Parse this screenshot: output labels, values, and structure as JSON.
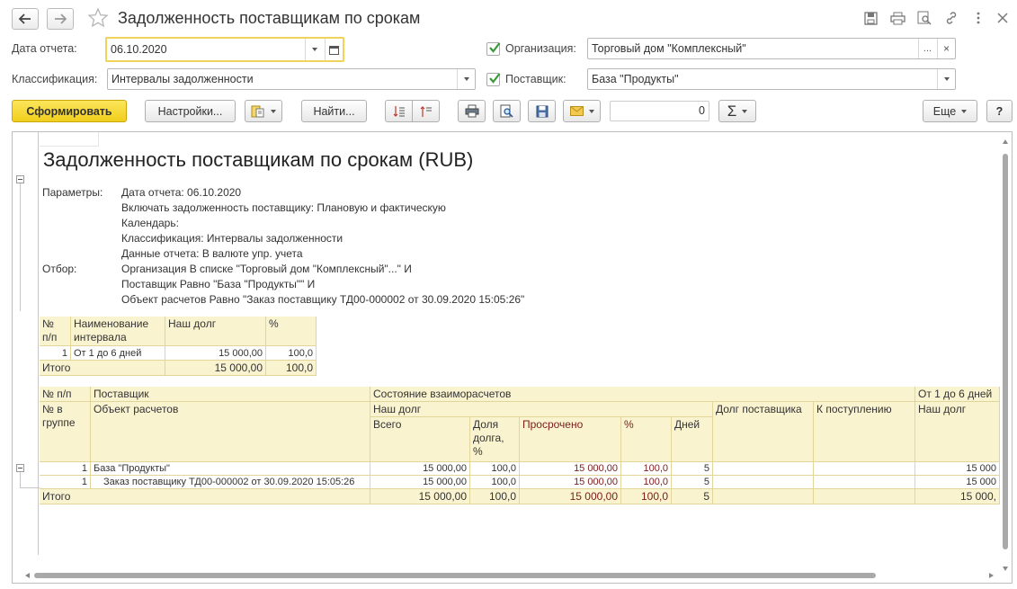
{
  "window": {
    "title": "Задолженность поставщикам по срокам"
  },
  "form": {
    "report_date_label": "Дата отчета:",
    "report_date_value": "06.10.2020",
    "classification_label": "Классификация:",
    "classification_value": "Интервалы задолженности",
    "organization_label": "Организация:",
    "organization_value": "Торговый дом \"Комплексный\"",
    "organization_checked": true,
    "organization_more": "...",
    "organization_clear": "×",
    "supplier_label": "Поставщик:",
    "supplier_value": "База \"Продукты\"",
    "supplier_checked": true
  },
  "toolbar": {
    "generate_label": "Сформировать",
    "settings_label": "Настройки...",
    "find_label": "Найти...",
    "sum_value": "0",
    "sum_symbol": "Σ",
    "more_label": "Еще",
    "help_label": "?"
  },
  "report": {
    "title": "Задолженность поставщикам по срокам (RUB)",
    "params_label": "Параметры:",
    "params": [
      "Дата отчета: 06.10.2020",
      "Включать задолженность поставщику: Плановую и фактическую",
      "Календарь:",
      "Классификация: Интервалы задолженности",
      "Данные отчета: В валюте упр. учета"
    ],
    "filter_label": "Отбор:",
    "filters": [
      "Организация В списке \"Торговый дом \"Комплексный\"...\" И",
      "Поставщик Равно \"База \"Продукты\"\" И",
      "Объект расчетов Равно \"Заказ поставщику ТД00-000002 от 30.09.2020 15:05:26\""
    ],
    "summary": {
      "headers": [
        "№\nп/п",
        "Наименование\nинтервала",
        "Наш долг",
        "%"
      ],
      "rows": [
        {
          "num": "1",
          "name": "От 1 до 6 дней",
          "debt": "15 000,00",
          "pct": "100,0"
        }
      ],
      "total": {
        "label": "Итого",
        "debt": "15 000,00",
        "pct": "100,0"
      }
    },
    "main": {
      "h_num": "№ п/п",
      "h_supplier": "Поставщик",
      "h_state": "Состояние взаиморасчетов",
      "h_interval": "От 1 до 6 дней",
      "h_num_group": "№ в\nгруппе",
      "h_object": "Объект расчетов",
      "h_our_debt": "Наш долг",
      "h_supplier_debt": "Долг поставщика",
      "h_incoming": "К поступлению",
      "h_interval_debt": "Наш долг",
      "h_total": "Всего",
      "h_share": "Доля\nдолга,\n%",
      "h_overdue": "Просрочено",
      "h_pct": "%",
      "h_days": "Дней",
      "group_row": {
        "num": "1",
        "name": "База \"Продукты\"",
        "total": "15 000,00",
        "share": "100,0",
        "overdue": "15 000,00",
        "pct": "100,0",
        "days": "5",
        "interval": "15 000"
      },
      "detail_row": {
        "num": "1",
        "name": "Заказ поставщику ТД00-000002 от 30.09.2020 15:05:26",
        "total": "15 000,00",
        "share": "100,0",
        "overdue": "15 000,00",
        "pct": "100,0",
        "days": "5",
        "interval": "15 000"
      },
      "total_row": {
        "label": "Итого",
        "total": "15 000,00",
        "share": "100,0",
        "overdue": "15 000,00",
        "pct": "100,0",
        "days": "5",
        "interval": "15 000,"
      }
    }
  },
  "colors": {
    "accent_yellow": "#f5d52a",
    "table_header": "#faf3d0",
    "overdue_text": "#7a1d1d",
    "checkbox_green": "#3a9a3a"
  }
}
